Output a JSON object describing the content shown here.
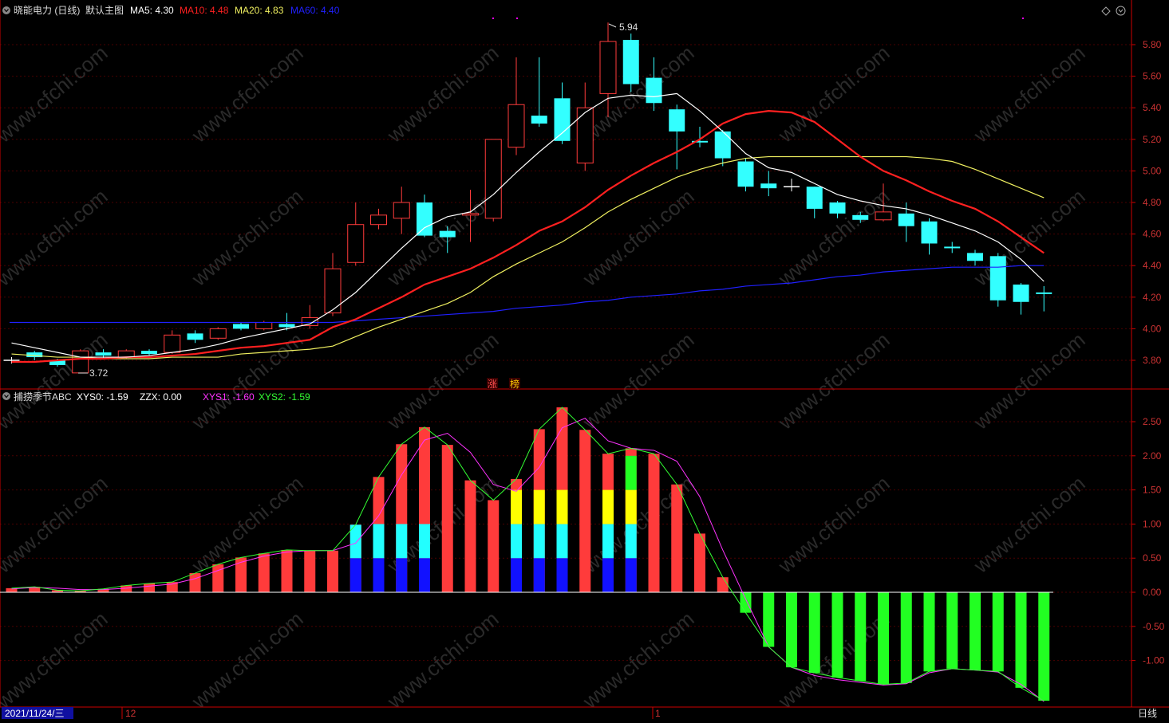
{
  "header": {
    "stock_title": "晓能电力 (日线)",
    "main_chart_label": "默认主图",
    "ma5": "MA5: 4.30",
    "ma10": "MA10: 4.48",
    "ma20": "MA20: 4.83",
    "ma60": "MA60: 4.40"
  },
  "indicator_header": {
    "name": "捕捞季节ABC",
    "xys0": "XYS0: -1.59",
    "zzx": "ZZX: 0.00",
    "xys1": "XYS1: -1.60",
    "xys2": "XYS2: -1.59"
  },
  "footer": {
    "date": "2021/11/24/三",
    "month_dec": "12",
    "month_jan": "1",
    "period": "日线"
  },
  "markers": {
    "high": "5.94",
    "low": "3.72",
    "tag1": "涨",
    "tag2": "榜"
  },
  "watermark": "www.cfchi.com",
  "colors": {
    "up": "#ff3b3b",
    "down": "#33ffff",
    "ma5": "#ffffff",
    "ma10": "#ff2020",
    "ma20": "#f0f060",
    "ma60": "#2020ff",
    "xys1": "#ff33ff",
    "xys2": "#33ff33",
    "axis": "#cc0000",
    "bar_green": "#22ff22",
    "bar_yellow": "#ffff00",
    "bar_cyan": "#22ffff",
    "bar_blue": "#1111ff"
  },
  "chart_data": [
    {
      "type": "candlestick",
      "ylim": [
        3.65,
        5.95
      ],
      "yticks": [
        "5.80",
        "5.60",
        "5.40",
        "5.20",
        "5.00",
        "4.80",
        "4.60",
        "4.40",
        "4.20",
        "4.00",
        "3.80"
      ],
      "candles": [
        {
          "o": 3.8,
          "c": 3.8,
          "h": 3.82,
          "l": 3.78
        },
        {
          "o": 3.85,
          "c": 3.82,
          "h": 3.86,
          "l": 3.8
        },
        {
          "o": 3.8,
          "c": 3.77,
          "h": 3.81,
          "l": 3.76
        },
        {
          "o": 3.72,
          "c": 3.86,
          "h": 3.87,
          "l": 3.72
        },
        {
          "o": 3.85,
          "c": 3.83,
          "h": 3.87,
          "l": 3.81
        },
        {
          "o": 3.82,
          "c": 3.86,
          "h": 3.87,
          "l": 3.81
        },
        {
          "o": 3.86,
          "c": 3.84,
          "h": 3.87,
          "l": 3.83
        },
        {
          "o": 3.85,
          "c": 3.96,
          "h": 3.99,
          "l": 3.84
        },
        {
          "o": 3.97,
          "c": 3.93,
          "h": 3.99,
          "l": 3.91
        },
        {
          "o": 3.94,
          "c": 4.0,
          "h": 4.01,
          "l": 3.93
        },
        {
          "o": 4.03,
          "c": 4.0,
          "h": 4.04,
          "l": 3.99
        },
        {
          "o": 4.0,
          "c": 4.04,
          "h": 4.05,
          "l": 3.99
        },
        {
          "o": 4.03,
          "c": 4.01,
          "h": 4.1,
          "l": 3.99
        },
        {
          "o": 4.02,
          "c": 4.07,
          "h": 4.15,
          "l": 4.0
        },
        {
          "o": 4.1,
          "c": 4.38,
          "h": 4.48,
          "l": 4.08
        },
        {
          "o": 4.42,
          "c": 4.66,
          "h": 4.8,
          "l": 4.4
        },
        {
          "o": 4.66,
          "c": 4.72,
          "h": 4.76,
          "l": 4.63
        },
        {
          "o": 4.7,
          "c": 4.8,
          "h": 4.9,
          "l": 4.6
        },
        {
          "o": 4.8,
          "c": 4.59,
          "h": 4.85,
          "l": 4.58
        },
        {
          "o": 4.62,
          "c": 4.58,
          "h": 4.65,
          "l": 4.48
        },
        {
          "o": 4.72,
          "c": 4.73,
          "h": 4.88,
          "l": 4.55
        },
        {
          "o": 4.7,
          "c": 5.2,
          "h": 5.2,
          "l": 4.68
        },
        {
          "o": 5.15,
          "c": 5.42,
          "h": 5.72,
          "l": 5.1
        },
        {
          "o": 5.35,
          "c": 5.3,
          "h": 5.72,
          "l": 5.28
        },
        {
          "o": 5.46,
          "c": 5.19,
          "h": 5.56,
          "l": 5.17
        },
        {
          "o": 5.05,
          "c": 5.4,
          "h": 5.56,
          "l": 5.0
        },
        {
          "o": 5.49,
          "c": 5.82,
          "h": 5.94,
          "l": 5.34
        },
        {
          "o": 5.83,
          "c": 5.55,
          "h": 5.87,
          "l": 5.5
        },
        {
          "o": 5.59,
          "c": 5.43,
          "h": 5.72,
          "l": 5.38
        },
        {
          "o": 5.39,
          "c": 5.25,
          "h": 5.42,
          "l": 5.01
        },
        {
          "o": 5.19,
          "c": 5.18,
          "h": 5.28,
          "l": 5.15
        },
        {
          "o": 5.25,
          "c": 5.08,
          "h": 5.26,
          "l": 5.03
        },
        {
          "o": 5.06,
          "c": 4.9,
          "h": 5.08,
          "l": 4.87
        },
        {
          "o": 4.92,
          "c": 4.89,
          "h": 5.0,
          "l": 4.84
        },
        {
          "o": 4.9,
          "c": 4.9,
          "h": 4.95,
          "l": 4.87
        },
        {
          "o": 4.9,
          "c": 4.76,
          "h": 4.9,
          "l": 4.7
        },
        {
          "o": 4.8,
          "c": 4.73,
          "h": 4.81,
          "l": 4.7
        },
        {
          "o": 4.72,
          "c": 4.69,
          "h": 4.74,
          "l": 4.67
        },
        {
          "o": 4.69,
          "c": 4.74,
          "h": 4.92,
          "l": 4.68
        },
        {
          "o": 4.73,
          "c": 4.65,
          "h": 4.8,
          "l": 4.55
        },
        {
          "o": 4.68,
          "c": 4.54,
          "h": 4.7,
          "l": 4.47
        },
        {
          "o": 4.52,
          "c": 4.51,
          "h": 4.55,
          "l": 4.48
        },
        {
          "o": 4.48,
          "c": 4.43,
          "h": 4.5,
          "l": 4.4
        },
        {
          "o": 4.46,
          "c": 4.18,
          "h": 4.48,
          "l": 4.14
        },
        {
          "o": 4.28,
          "c": 4.17,
          "h": 4.29,
          "l": 4.09
        },
        {
          "o": 4.23,
          "c": 4.22,
          "h": 4.27,
          "l": 4.11
        }
      ],
      "ma5": [
        3.91,
        3.88,
        3.85,
        3.82,
        3.82,
        3.82,
        3.83,
        3.85,
        3.87,
        3.9,
        3.94,
        3.97,
        4.0,
        4.03,
        4.12,
        4.23,
        4.37,
        4.51,
        4.64,
        4.71,
        4.74,
        4.85,
        4.99,
        5.12,
        5.24,
        5.37,
        5.46,
        5.48,
        5.47,
        5.49,
        5.38,
        5.25,
        5.11,
        5.02,
        4.99,
        4.92,
        4.85,
        4.81,
        4.78,
        4.76,
        4.72,
        4.67,
        4.62,
        4.55,
        4.44,
        4.3
      ],
      "ma10": [
        3.79,
        3.79,
        3.8,
        3.81,
        3.81,
        3.82,
        3.82,
        3.83,
        3.84,
        3.86,
        3.88,
        3.89,
        3.91,
        3.93,
        4.01,
        4.06,
        4.13,
        4.2,
        4.28,
        4.33,
        4.38,
        4.45,
        4.53,
        4.62,
        4.68,
        4.77,
        4.88,
        4.97,
        5.05,
        5.12,
        5.2,
        5.3,
        5.36,
        5.38,
        5.37,
        5.31,
        5.2,
        5.09,
        5.0,
        4.94,
        4.87,
        4.81,
        4.76,
        4.68,
        4.58,
        4.48
      ],
      "ma20": [
        3.84,
        3.83,
        3.82,
        3.82,
        3.81,
        3.81,
        3.81,
        3.82,
        3.82,
        3.82,
        3.84,
        3.85,
        3.86,
        3.87,
        3.89,
        3.95,
        4.01,
        4.06,
        4.11,
        4.16,
        4.23,
        4.33,
        4.41,
        4.48,
        4.55,
        4.64,
        4.74,
        4.82,
        4.89,
        4.96,
        5.01,
        5.05,
        5.08,
        5.09,
        5.09,
        5.09,
        5.09,
        5.09,
        5.09,
        5.09,
        5.08,
        5.06,
        5.01,
        4.95,
        4.89,
        4.83
      ],
      "ma60": [
        4.04,
        4.04,
        4.04,
        4.04,
        4.04,
        4.04,
        4.04,
        4.04,
        4.04,
        4.04,
        4.04,
        4.04,
        4.04,
        4.04,
        4.04,
        4.05,
        4.06,
        4.07,
        4.08,
        4.09,
        4.1,
        4.11,
        4.13,
        4.14,
        4.15,
        4.17,
        4.18,
        4.2,
        4.21,
        4.22,
        4.24,
        4.25,
        4.27,
        4.28,
        4.29,
        4.31,
        4.33,
        4.34,
        4.36,
        4.37,
        4.38,
        4.39,
        4.39,
        4.39,
        4.4,
        4.4
      ]
    },
    {
      "type": "bar",
      "name": "捕捞季节ABC",
      "ylim": [
        -1.65,
        2.9
      ],
      "yticks": [
        "2.50",
        "2.00",
        "1.50",
        "1.00",
        "0.50",
        "0.00",
        "-0.50",
        "-1.00"
      ],
      "xys0": [
        0.06,
        0.08,
        0.03,
        0.02,
        0.05,
        0.1,
        0.13,
        0.15,
        0.28,
        0.41,
        0.51,
        0.57,
        0.62,
        0.61,
        0.61,
        0.99,
        1.69,
        2.17,
        2.42,
        2.16,
        1.64,
        1.35,
        1.66,
        2.39,
        2.71,
        2.38,
        2.03,
        2.11,
        2.03,
        1.58,
        0.86,
        0.22,
        -0.3,
        -0.8,
        -1.1,
        -1.18,
        -1.25,
        -1.3,
        -1.35,
        -1.33,
        -1.16,
        -1.12,
        -1.14,
        -1.16,
        -1.4,
        -1.59
      ],
      "xys1": [
        0.05,
        0.07,
        0.06,
        0.04,
        0.04,
        0.06,
        0.09,
        0.12,
        0.2,
        0.32,
        0.44,
        0.53,
        0.59,
        0.61,
        0.61,
        0.72,
        1.12,
        1.72,
        2.23,
        2.33,
        2.05,
        1.58,
        1.48,
        1.83,
        2.41,
        2.55,
        2.22,
        2.11,
        2.08,
        1.92,
        1.4,
        0.62,
        -0.1,
        -0.8,
        -1.1,
        -1.22,
        -1.28,
        -1.32,
        -1.36,
        -1.34,
        -1.18,
        -1.12,
        -1.14,
        -1.17,
        -1.35,
        -1.6
      ],
      "xys2": [
        0.06,
        0.08,
        0.03,
        0.02,
        0.05,
        0.1,
        0.13,
        0.15,
        0.28,
        0.41,
        0.51,
        0.57,
        0.62,
        0.61,
        0.61,
        0.99,
        1.69,
        2.17,
        2.42,
        2.16,
        1.64,
        1.35,
        1.66,
        2.39,
        2.71,
        2.38,
        2.03,
        2.11,
        2.03,
        1.58,
        0.86,
        0.22,
        -0.3,
        -0.8,
        -1.1,
        -1.18,
        -1.25,
        -1.3,
        -1.35,
        -1.33,
        -1.16,
        -1.12,
        -1.14,
        -1.16,
        -1.4,
        -1.59
      ],
      "season": [
        0,
        0,
        0,
        0,
        0,
        0,
        0,
        0,
        0,
        0,
        0,
        0,
        0,
        0,
        0,
        2,
        2,
        2,
        2,
        0,
        0,
        0,
        3,
        3,
        3,
        0,
        3,
        4,
        0,
        0,
        0,
        0,
        0,
        0,
        0,
        0,
        0,
        0,
        0,
        0,
        0,
        0,
        0,
        0,
        0,
        0
      ]
    }
  ]
}
